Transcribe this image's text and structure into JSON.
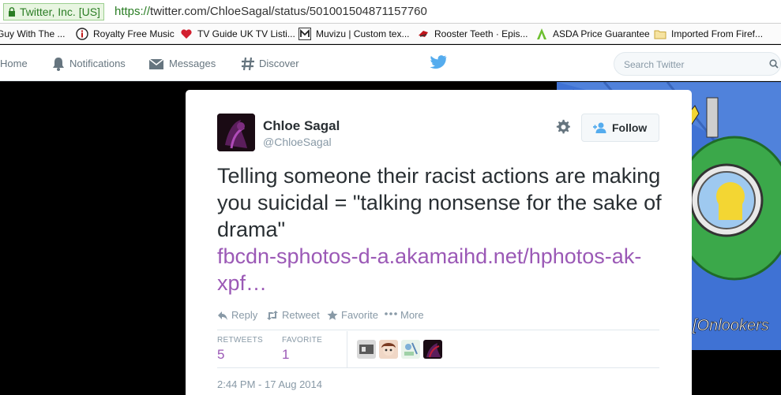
{
  "browser": {
    "site_identity": "Twitter, Inc. [US]",
    "url_scheme": "https://",
    "url_rest": "twitter.com/ChloeSagal/status/501001504871157760"
  },
  "bookmarks": [
    {
      "label": "Guy With The ...",
      "icon": "page-icon"
    },
    {
      "label": "Royalty Free Music",
      "icon": "info-icon"
    },
    {
      "label": "TV Guide UK TV Listi...",
      "icon": "heart-tv-icon"
    },
    {
      "label": "Muvizu | Custom tex...",
      "icon": "muvizu-icon"
    },
    {
      "label": "Rooster Teeth · Epis...",
      "icon": "rooster-icon"
    },
    {
      "label": "ASDA Price Guarantee",
      "icon": "asda-icon"
    },
    {
      "label": "Imported From Firef...",
      "icon": "folder-icon"
    }
  ],
  "nav": {
    "home": "Home",
    "notifications": "Notifications",
    "messages": "Messages",
    "discover": "Discover",
    "search_placeholder": "Search Twitter"
  },
  "tweet": {
    "fullname": "Chloe Sagal",
    "username": "@ChloeSagal",
    "follow_label": "Follow",
    "text": "Telling someone their racist actions are making you suicidal = \"talking nonsense for the sake of drama\"",
    "link": "fbcdn-sphotos-d-a.akamaihd.net/hphotos-ak-xpf…",
    "actions": {
      "reply": "Reply",
      "retweet": "Retweet",
      "favorite": "Favorite",
      "more": "More"
    },
    "stats": {
      "retweets_label": "RETWEETS",
      "retweets_value": "5",
      "favorites_label": "FAVORITE",
      "favorites_value": "1"
    },
    "timestamp": "2:44 PM - 17 Aug 2014"
  },
  "background": {
    "caption": "[Onlookers"
  },
  "colors": {
    "link": "#9b59b6",
    "twitter_blue": "#55acee",
    "secure_green": "#2a7d24",
    "text_dark": "#292f33",
    "text_muted": "#8899a6"
  }
}
